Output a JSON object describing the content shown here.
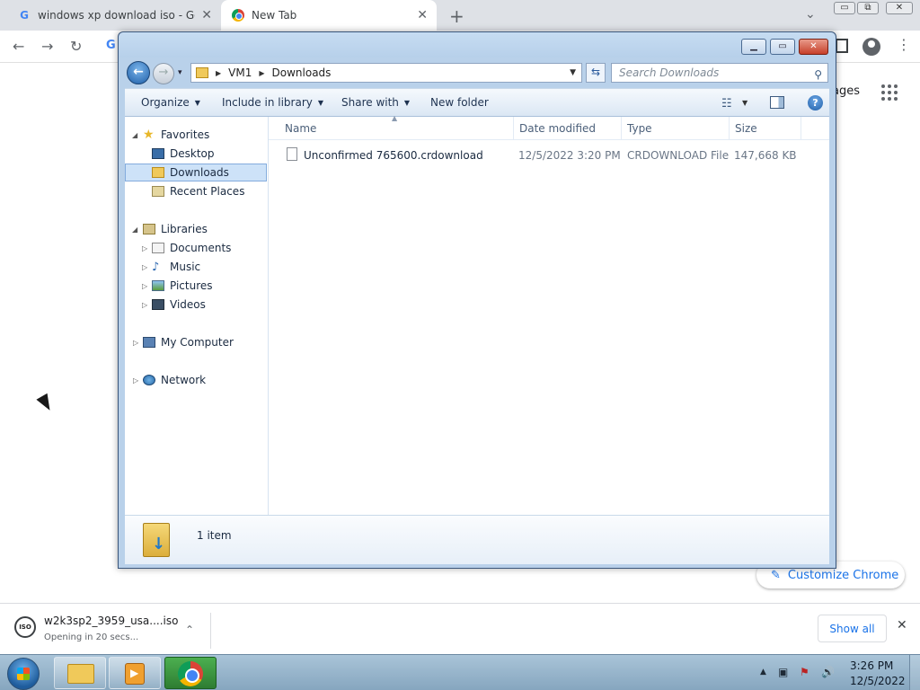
{
  "chrome": {
    "tabs": [
      {
        "title": "windows xp download iso - Goo",
        "close": "✕"
      },
      {
        "title": "New Tab",
        "close": "✕"
      }
    ],
    "new_tab": "+",
    "tab_search": "⌄",
    "window_controls": {
      "min": "▭",
      "max": "⧉",
      "close": "✕"
    },
    "toolbar": {
      "back": "←",
      "forward": "→",
      "reload": "↻",
      "omnibox_icon": "G",
      "menu": "⋮"
    },
    "page": {
      "images_link": "ages",
      "customize_label": "Customize Chrome",
      "customize_icon": "✎"
    }
  },
  "download_shelf": {
    "file_name": "w2k3sp2_3959_usa....iso",
    "status": "Opening in 20 secs...",
    "icon_label": "ISO",
    "caret": "⌃",
    "show_all": "Show all",
    "close": "✕"
  },
  "explorer": {
    "window_controls": {
      "min": "▁",
      "max": "▭",
      "close": "✕"
    },
    "nav_buttons": {
      "back": "←",
      "forward": "→",
      "recent": "▾"
    },
    "breadcrumbs": [
      "VM1",
      "Downloads"
    ],
    "crumb_separator": "▶",
    "address_dropdown": "▼",
    "refresh": "⇆",
    "search_placeholder": "Search Downloads",
    "search_icon": "⚲",
    "commands": [
      "Organize",
      "Include in library",
      "Share with",
      "New folder"
    ],
    "command_caret": "▼",
    "views_icon": "☷",
    "views_dropdown": "▼",
    "help": "?",
    "nav": {
      "expand_arrow": "◢",
      "collapse_arrow": "▷",
      "favorites": "Favorites",
      "favorites_items": [
        "Desktop",
        "Downloads",
        "Recent Places"
      ],
      "libraries": "Libraries",
      "libraries_items": [
        "Documents",
        "Music",
        "Pictures",
        "Videos"
      ],
      "my_computer": "My Computer",
      "network": "Network",
      "star_icon": "★",
      "music_icon": "♪"
    },
    "columns": [
      "Name",
      "Date modified",
      "Type",
      "Size"
    ],
    "sort_caret": "▲",
    "files": [
      {
        "name": "Unconfirmed 765600.crdownload",
        "date": "12/5/2022 3:20 PM",
        "type": "CRDOWNLOAD File",
        "size": "147,668 KB"
      }
    ],
    "status": {
      "item_count": "1 item"
    }
  },
  "taskbar": {
    "tray_icons": [
      "▲",
      "▣",
      "⚑",
      "🔊"
    ],
    "clock_time": "3:26 PM",
    "clock_date": "12/5/2022"
  },
  "colors": {
    "chrome_accent": "#1a73e8",
    "explorer_frame": "#b9d1ea",
    "selection": "#cde2f8",
    "close_red": "#c7402a"
  }
}
